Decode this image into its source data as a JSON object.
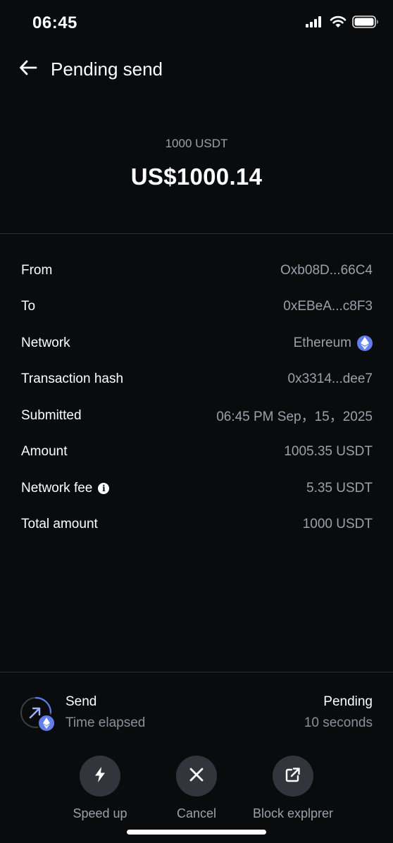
{
  "status_bar": {
    "time": "06:45",
    "icons": [
      "signal-icon",
      "wifi-icon",
      "battery-icon"
    ]
  },
  "header": {
    "back_icon": "arrow-left-icon",
    "title": "Pending send"
  },
  "amount": {
    "token": "1000 USDT",
    "fiat": "US$1000.14"
  },
  "details": {
    "from": {
      "label": "From",
      "value": "Oxb08D...66C4"
    },
    "to": {
      "label": "To",
      "value": "0xEBeA...c8F3"
    },
    "network": {
      "label": "Network",
      "value": "Ethereum",
      "icon": "ethereum-icon"
    },
    "tx_hash": {
      "label": "Transaction hash",
      "value": "0x3314...dee7"
    },
    "submitted": {
      "label": "Submitted",
      "value": "06:45 PM Sep，15，2025"
    },
    "amount": {
      "label": "Amount",
      "value": "1005.35 USDT"
    },
    "fee": {
      "label": "Network fee",
      "value": "5.35 USDT",
      "icon": "info-icon"
    },
    "total": {
      "label": "Total amount",
      "value": "1000 USDT"
    }
  },
  "transaction": {
    "title": "Send",
    "subtitle": "Time elapsed",
    "status": "Pending",
    "elapsed": "10 seconds"
  },
  "actions": {
    "speed_up": {
      "label": "Speed up",
      "icon": "lightning-icon"
    },
    "cancel": {
      "label": "Cancel",
      "icon": "close-icon"
    },
    "explorer": {
      "label": "Block explprer",
      "icon": "external-link-icon"
    }
  },
  "colors": {
    "background": "#0a0b0d",
    "muted_text": "#9aa1ab",
    "ethereum": "#627eea",
    "button_bg": "#32353c"
  }
}
